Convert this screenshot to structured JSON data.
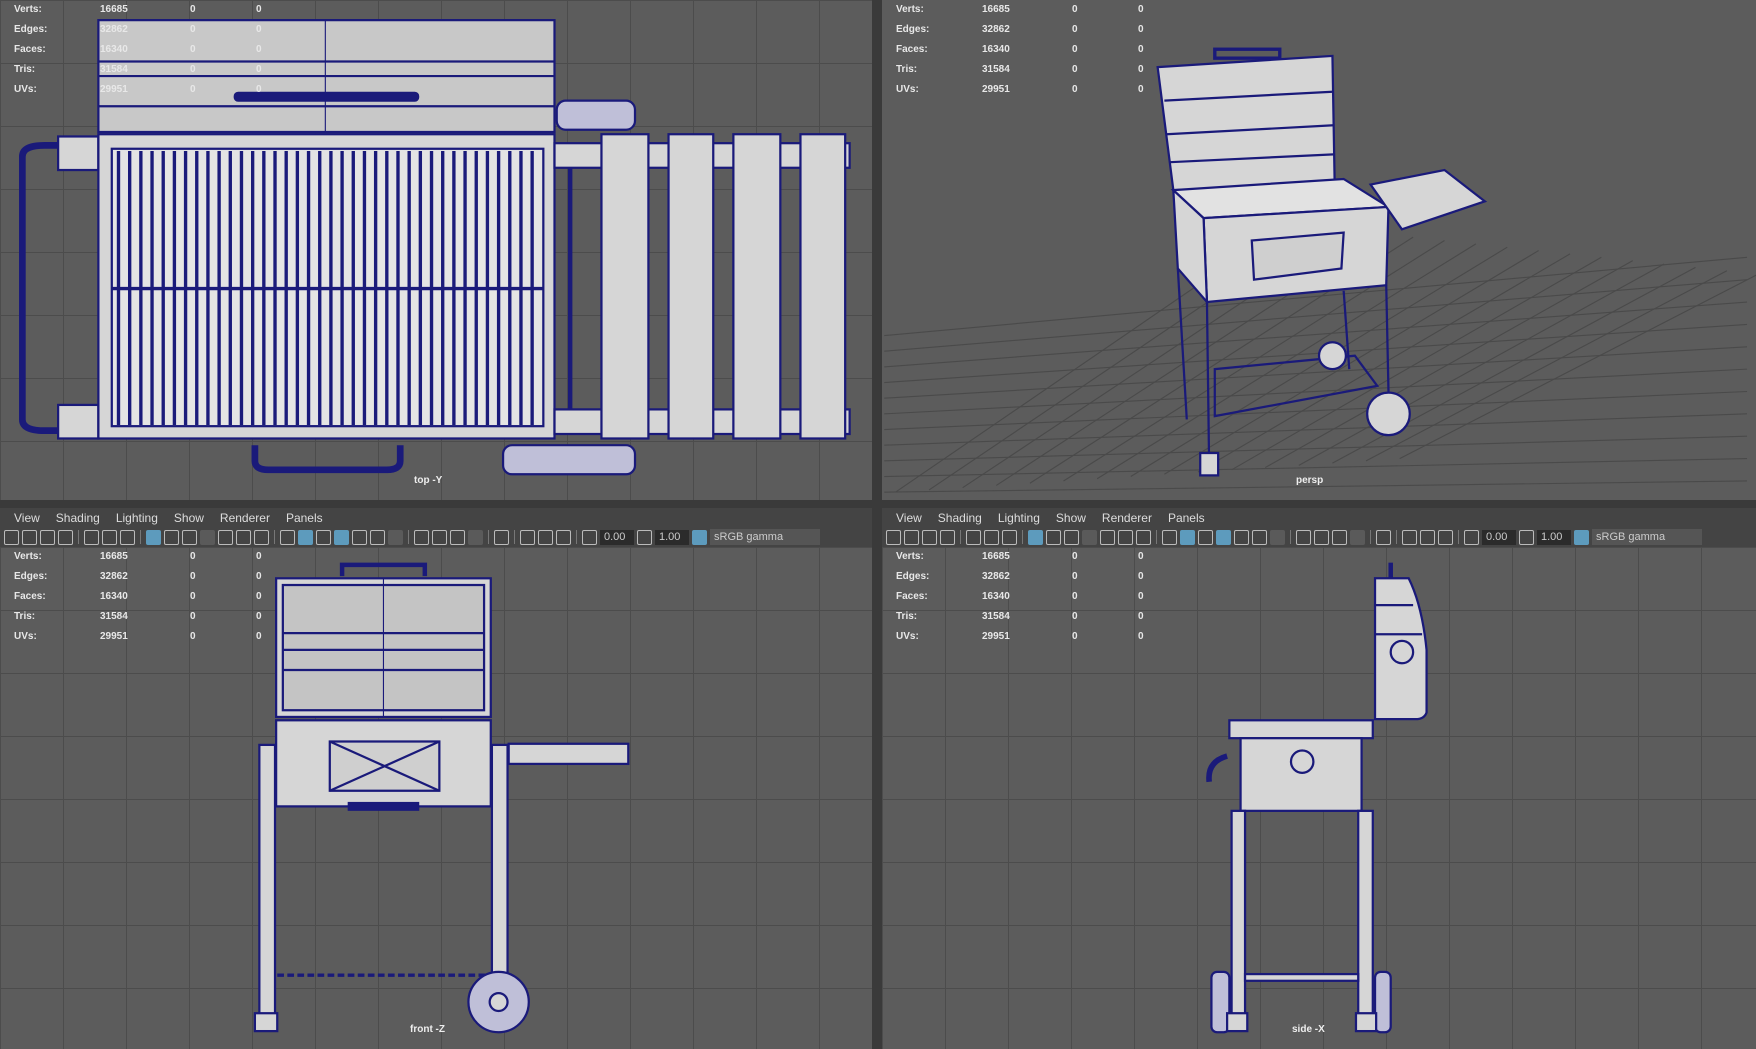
{
  "menu": [
    "View",
    "Shading",
    "Lighting",
    "Show",
    "Renderer",
    "Panels"
  ],
  "hud": {
    "rows": [
      {
        "label": "Verts:",
        "v1": "16685",
        "v2": "0",
        "v3": "0"
      },
      {
        "label": "Edges:",
        "v1": "32862",
        "v2": "0",
        "v3": "0"
      },
      {
        "label": "Faces:",
        "v1": "16340",
        "v2": "0",
        "v3": "0"
      },
      {
        "label": "Tris:",
        "v1": "31584",
        "v2": "0",
        "v3": "0"
      },
      {
        "label": "UVs:",
        "v1": "29951",
        "v2": "0",
        "v3": "0"
      }
    ]
  },
  "toolbar": {
    "exposure": "0.00",
    "gamma_value": "1.00",
    "color_space": "sRGB gamma"
  },
  "viewports": {
    "top": "top -Y",
    "persp": "persp",
    "front": "front -Z",
    "side": "side -X"
  },
  "colors": {
    "wire": "#1a1a7a",
    "mesh": "#d6d6d6",
    "grid_bg": "#5c5c5c",
    "active": "#5d9bbd"
  }
}
